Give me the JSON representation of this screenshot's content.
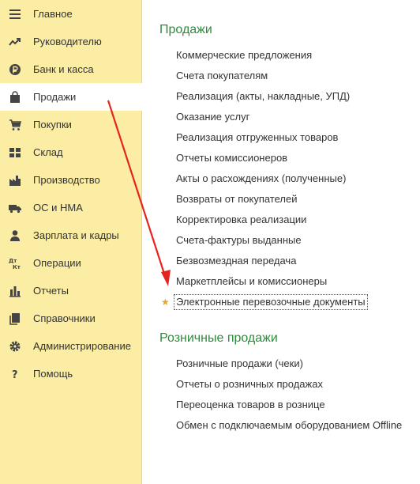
{
  "sidebar": {
    "items": [
      {
        "label": "Главное",
        "icon": "menu-lines-icon"
      },
      {
        "label": "Руководителю",
        "icon": "trend-up-icon"
      },
      {
        "label": "Банк и касса",
        "icon": "ruble-icon"
      },
      {
        "label": "Продажи",
        "icon": "shopping-bag-icon",
        "active": true
      },
      {
        "label": "Покупки",
        "icon": "cart-icon"
      },
      {
        "label": "Склад",
        "icon": "grid-icon"
      },
      {
        "label": "Производство",
        "icon": "factory-icon"
      },
      {
        "label": "ОС и НМА",
        "icon": "truck-icon"
      },
      {
        "label": "Зарплата и кадры",
        "icon": "person-icon"
      },
      {
        "label": "Операции",
        "icon": "dt-kt-icon"
      },
      {
        "label": "Отчеты",
        "icon": "bar-chart-icon"
      },
      {
        "label": "Справочники",
        "icon": "books-icon"
      },
      {
        "label": "Администрирование",
        "icon": "gear-icon"
      },
      {
        "label": "Помощь",
        "icon": "question-icon"
      }
    ],
    "icon_glyphs": {
      "dt": "Дт",
      "kt": "Кт",
      "help": "?"
    }
  },
  "content": {
    "sections": [
      {
        "title": "Продажи",
        "links": [
          "Коммерческие предложения",
          "Счета покупателям",
          "Реализация (акты, накладные, УПД)",
          "Оказание услуг",
          "Реализация отгруженных товаров",
          "Отчеты комиссионеров",
          "Акты о расхождениях (полученные)",
          "Возвраты от покупателей",
          "Корректировка реализации",
          "Счета-фактуры выданные",
          "Безвозмездная передача",
          "Маркетплейсы и комиссионеры",
          "Электронные перевозочные документы"
        ]
      },
      {
        "title": "Розничные продажи",
        "links": [
          "Розничные продажи (чеки)",
          "Отчеты о розничных продажах",
          "Переоценка товаров в рознице",
          "Обмен с подключаемым оборудованием Offline"
        ]
      }
    ],
    "favorite_marker": "★"
  },
  "colors": {
    "sidebar_bg": "#fbeda3",
    "section_title": "#2e8b3c",
    "link_text": "#333333",
    "star": "#e3a52a",
    "annotation_arrow": "#e52420"
  }
}
